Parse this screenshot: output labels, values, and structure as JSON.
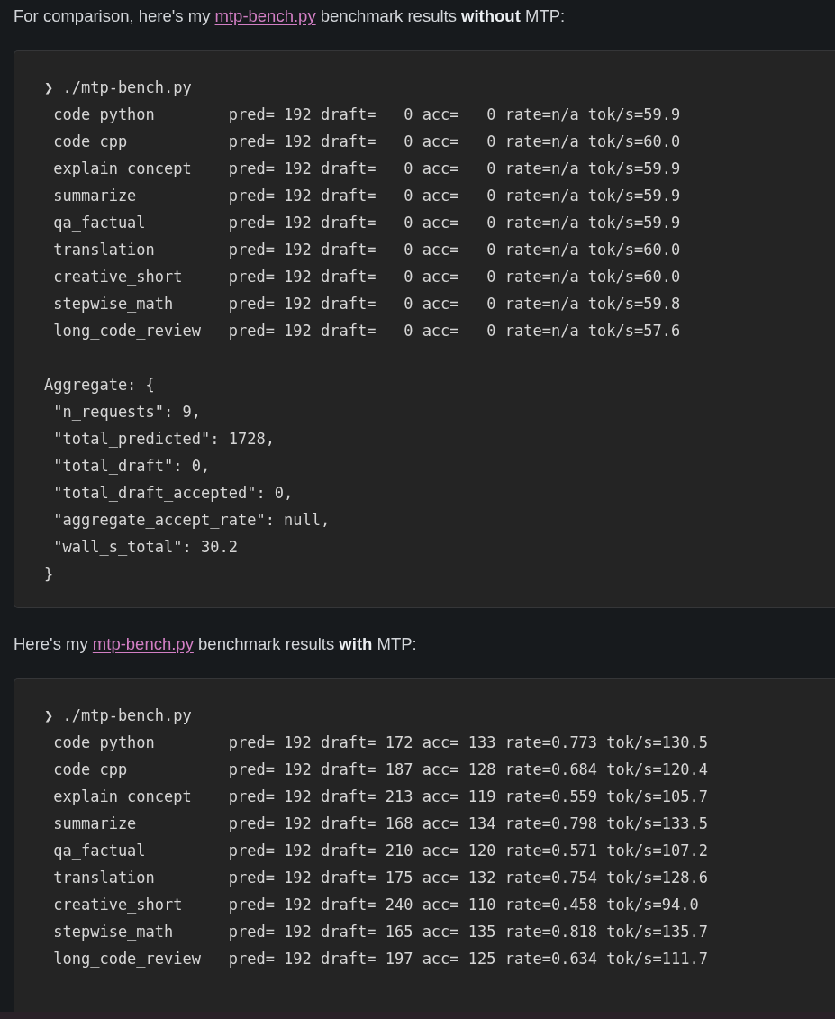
{
  "sections": [
    {
      "intro": {
        "before": "For comparison, here's my ",
        "link": "mtp-bench.py",
        "after": " benchmark results **without** MTP:"
      },
      "code_groups": [
        [
          "❯ ./mtp-bench.py",
          " code_python        pred= 192 draft=   0 acc=   0 rate=n/a tok/s=59.9",
          " code_cpp           pred= 192 draft=   0 acc=   0 rate=n/a tok/s=60.0",
          " explain_concept    pred= 192 draft=   0 acc=   0 rate=n/a tok/s=59.9",
          " summarize          pred= 192 draft=   0 acc=   0 rate=n/a tok/s=59.9",
          " qa_factual         pred= 192 draft=   0 acc=   0 rate=n/a tok/s=59.9",
          " translation        pred= 192 draft=   0 acc=   0 rate=n/a tok/s=60.0",
          " creative_short     pred= 192 draft=   0 acc=   0 rate=n/a tok/s=60.0",
          " stepwise_math      pred= 192 draft=   0 acc=   0 rate=n/a tok/s=59.8",
          " long_code_review   pred= 192 draft=   0 acc=   0 rate=n/a tok/s=57.6"
        ],
        [
          "Aggregate: {",
          " \"n_requests\": 9,",
          " \"total_predicted\": 1728,",
          " \"total_draft\": 0,",
          " \"total_draft_accepted\": 0,",
          " \"aggregate_accept_rate\": null,",
          " \"wall_s_total\": 30.2",
          "}"
        ]
      ]
    },
    {
      "intro": {
        "before": "Here's my ",
        "link": "mtp-bench.py",
        "after": " benchmark results **with** MTP:"
      },
      "code_groups": [
        [
          "❯ ./mtp-bench.py",
          " code_python        pred= 192 draft= 172 acc= 133 rate=0.773 tok/s=130.5",
          " code_cpp           pred= 192 draft= 187 acc= 128 rate=0.684 tok/s=120.4",
          " explain_concept    pred= 192 draft= 213 acc= 119 rate=0.559 tok/s=105.7",
          " summarize          pred= 192 draft= 168 acc= 134 rate=0.798 tok/s=133.5",
          " qa_factual         pred= 192 draft= 210 acc= 120 rate=0.571 tok/s=107.2",
          " translation        pred= 192 draft= 175 acc= 132 rate=0.754 tok/s=128.6",
          " creative_short     pred= 192 draft= 240 acc= 110 rate=0.458 tok/s=94.0",
          " stepwise_math      pred= 192 draft= 165 acc= 135 rate=0.818 tok/s=135.7",
          " long_code_review   pred= 192 draft= 197 acc= 125 rate=0.634 tok/s=111.7"
        ]
      ]
    }
  ]
}
